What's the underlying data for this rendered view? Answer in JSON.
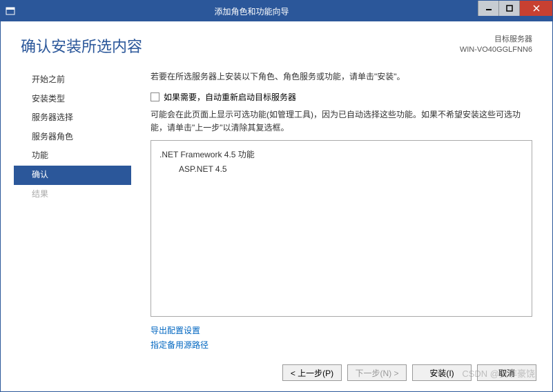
{
  "window": {
    "title": "添加角色和功能向导"
  },
  "header": {
    "page_title": "确认安装所选内容",
    "target_label": "目标服务器",
    "target_server": "WIN-VO40GGLFNN6"
  },
  "sidebar": {
    "items": [
      {
        "label": "开始之前",
        "state": "normal"
      },
      {
        "label": "安装类型",
        "state": "normal"
      },
      {
        "label": "服务器选择",
        "state": "normal"
      },
      {
        "label": "服务器角色",
        "state": "normal"
      },
      {
        "label": "功能",
        "state": "normal"
      },
      {
        "label": "确认",
        "state": "active"
      },
      {
        "label": "结果",
        "state": "disabled"
      }
    ]
  },
  "panel": {
    "intro": "若要在所选服务器上安装以下角色、角色服务或功能，请单击\"安装\"。",
    "checkbox_label": "如果需要，自动重新启动目标服务器",
    "note": "可能会在此页面上显示可选功能(如管理工具)，因为已自动选择这些功能。如果不希望安装这些可选功能，请单击\"上一步\"以清除其复选框。",
    "features": [
      {
        "text": ".NET Framework 4.5 功能",
        "indent": 0
      },
      {
        "text": "ASP.NET 4.5",
        "indent": 1
      }
    ],
    "links": {
      "export": "导出配置设置",
      "alt_source": "指定备用源路径"
    }
  },
  "buttons": {
    "prev": "< 上一步(P)",
    "next": "下一步(N) >",
    "install": "安装(I)",
    "cancel": "取消"
  },
  "watermark": "CSDN @莫非豪饶"
}
